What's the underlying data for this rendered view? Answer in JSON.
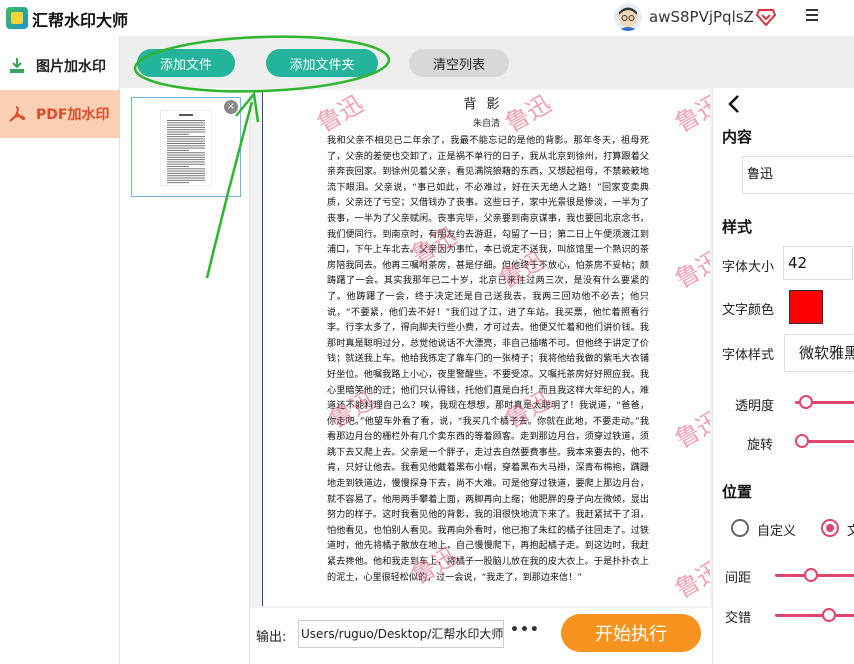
{
  "app": {
    "title": "汇帮水印大师"
  },
  "user": {
    "name": "awS8PVjPqlsZ"
  },
  "icons": {
    "app_logo": "app-logo-icon",
    "avatar": "user-avatar",
    "vip": "vip-diamond-icon",
    "menu": "hamburger-menu-icon",
    "image_watermark": "image-watermark-icon",
    "pdf_watermark": "pdf-icon",
    "close": "close-icon",
    "back": "back-arrow-icon"
  },
  "colors": {
    "teal_button": "#24b39b",
    "pdf_nav_bg": "#fbcfb3",
    "pdf_nav_text": "#e0492a",
    "start_button": "#f7931e",
    "accent": "#e0456d",
    "watermark_color": "#ff0000",
    "annotation": "#2db52d"
  },
  "sidebar": {
    "items": [
      {
        "label": "图片加水印",
        "active": false
      },
      {
        "label": "PDF加水印",
        "active": true
      }
    ]
  },
  "toolbar": {
    "add_file": "添加文件",
    "add_folder": "添加文件夹",
    "clear_list": "清空列表"
  },
  "file_list": {
    "close_glyph": "×"
  },
  "preview": {
    "watermark_text": "鲁迅",
    "doc_title": "背影",
    "doc_author": "朱自清",
    "doc_body": "我和父亲不相见已二年余了，我最不能忘记的是他的背影。那年冬天，祖母死了，父亲的差使也交卸了，正是祸不单行的日子，我从北京到徐州，打算跟着父亲奔丧回家。到徐州见着父亲，看见满院狼藉的东西，又想起祖母，不禁簌簌地流下眼泪。父亲说，“事已如此，不必难过，好在天无绝人之路！”回家变卖典质，父亲还了亏空；又借钱办了丧事。这些日子，家中光景很是惨淡，一半为了丧事，一半为了父亲赋闲。丧事完毕，父亲要到南京谋事，我也要回北京念书，我们便同行。到南京时，有朋友约去游逛，勾留了一日；第二日上午便须渡江到浦口，下午上车北去。父亲因为事忙，本已说定不送我，叫旅馆里一个熟识的茶房陪我同去。他再三嘱咐茶房，甚是仔细。但他终于不放心，怕茶房不妥帖；颇踌躇了一会。其实我那年已二十岁，北京已来往过两三次，是没有什么要紧的了。他踌躇了一会，终于决定还是自己送我去。我两三回劝他不必去；他只说，“不要紧，他们去不好！”我们过了江，进了车站。我买票，他忙着照看行李。行李太多了，得向脚夫行些小费，才可过去。他便又忙着和他们讲价钱。我那时真是聪明过分，总觉他说话不大漂亮，非自己插嘴不可。但他终于讲定了价钱；就送我上车。他给我拣定了靠车门的一张椅子；我将他给我做的紫毛大衣铺好坐位。他嘱我路上小心，夜里警醒些，不要受凉。又嘱托茶房好好照应我。我心里暗笑他的迂；他们只认得钱，托他们直是白托！而且我这样大年纪的人，难道还不能料理自己么？唉，我现在想想，那时真是太聪明了！我说道，“爸爸，你走吧。”他望车外看了看，说，“我买几个橘子去。你就在此地，不要走动。”我看那边月台的栅栏外有几个卖东西的等着顾客。走到那边月台，须穿过铁道，须跳下去又爬上去。父亲是一个胖子，走过去自然要费事些。我本来要去的，他不肯，只好让他去。我看见他戴着黑布小帽，穿着黑布大马褂，深青布棉袍，蹒跚地走到铁道边，慢慢探身下去，尚不大难。可是他穿过铁道，要爬上那边月台，就不容易了。他用两手攀着上面，两脚再向上缩；他肥胖的身子向左微倾，显出努力的样子。这时我看见他的背影，我的泪很快地流下来了。我赶紧拭干了泪，怕他看见，也怕别人看见。我再向外看时，他已抱了朱红的橘子往回走了。过铁道时，他先将橘子散放在地上，自己慢慢爬下，再抱起橘子走。到这边时，我赶紧去搀他。他和我走到车上，将橘子一股脑儿放在我的皮大衣上。于是扑扑衣上的泥土，心里很轻松似的，过一会说，“我走了，到那边来信！”"
  },
  "output": {
    "label": "输出:",
    "path": "Users/ruguo/Desktop/汇帮水印大师",
    "more": "•••",
    "start": "开始执行"
  },
  "panel": {
    "content_heading": "内容",
    "content_value": "鲁迅",
    "style_heading": "样式",
    "size_label": "字体大小",
    "size_value": "42",
    "color_label": "文字颜色",
    "font_label": "字体样式",
    "font_value": "微软雅黑",
    "opacity_label": "透明度",
    "opacity_level": 0.15,
    "rotate_label": "旋转",
    "rotate_level": 0.1,
    "position_heading": "位置",
    "radio_custom": "自定义",
    "radio_other": "文",
    "spacing_label": "间距",
    "spacing_level": 0.4,
    "stagger_label": "交错",
    "stagger_level": 0.6
  }
}
